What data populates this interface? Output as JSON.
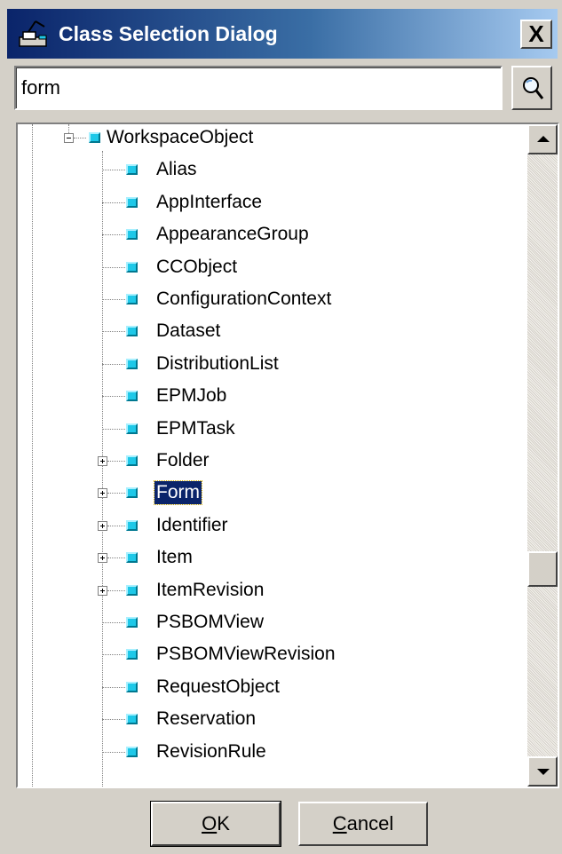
{
  "window": {
    "title": "Class Selection Dialog",
    "close_symbol": "X",
    "title_icon": "class-selector-icon",
    "accent_colors": {
      "titlebar_start": "#0a246a",
      "titlebar_end": "#a6caf0",
      "node_icon": "#1ec8e8",
      "selection": "#0a246a"
    }
  },
  "search": {
    "value": "form",
    "button_icon": "magnifier-icon"
  },
  "tree": {
    "root": {
      "label": "WorkspaceObject",
      "expanded": true
    },
    "children": [
      {
        "label": "Alias",
        "expandable": false
      },
      {
        "label": "AppInterface",
        "expandable": false
      },
      {
        "label": "AppearanceGroup",
        "expandable": false
      },
      {
        "label": "CCObject",
        "expandable": false
      },
      {
        "label": "ConfigurationContext",
        "expandable": false
      },
      {
        "label": "Dataset",
        "expandable": false
      },
      {
        "label": "DistributionList",
        "expandable": false
      },
      {
        "label": "EPMJob",
        "expandable": false
      },
      {
        "label": "EPMTask",
        "expandable": false
      },
      {
        "label": "Folder",
        "expandable": true
      },
      {
        "label": "Form",
        "expandable": true,
        "selected": true
      },
      {
        "label": "Identifier",
        "expandable": true
      },
      {
        "label": "Item",
        "expandable": true
      },
      {
        "label": "ItemRevision",
        "expandable": true
      },
      {
        "label": "PSBOMView",
        "expandable": false
      },
      {
        "label": "PSBOMViewRevision",
        "expandable": false
      },
      {
        "label": "RequestObject",
        "expandable": false
      },
      {
        "label": "Reservation",
        "expandable": false
      },
      {
        "label": "RevisionRule",
        "expandable": false
      }
    ]
  },
  "scrollbar": {
    "position_fraction": 0.7
  },
  "buttons": {
    "ok": {
      "mnemonic": "O",
      "rest": "K"
    },
    "cancel": {
      "mnemonic": "C",
      "rest": "ancel"
    }
  }
}
